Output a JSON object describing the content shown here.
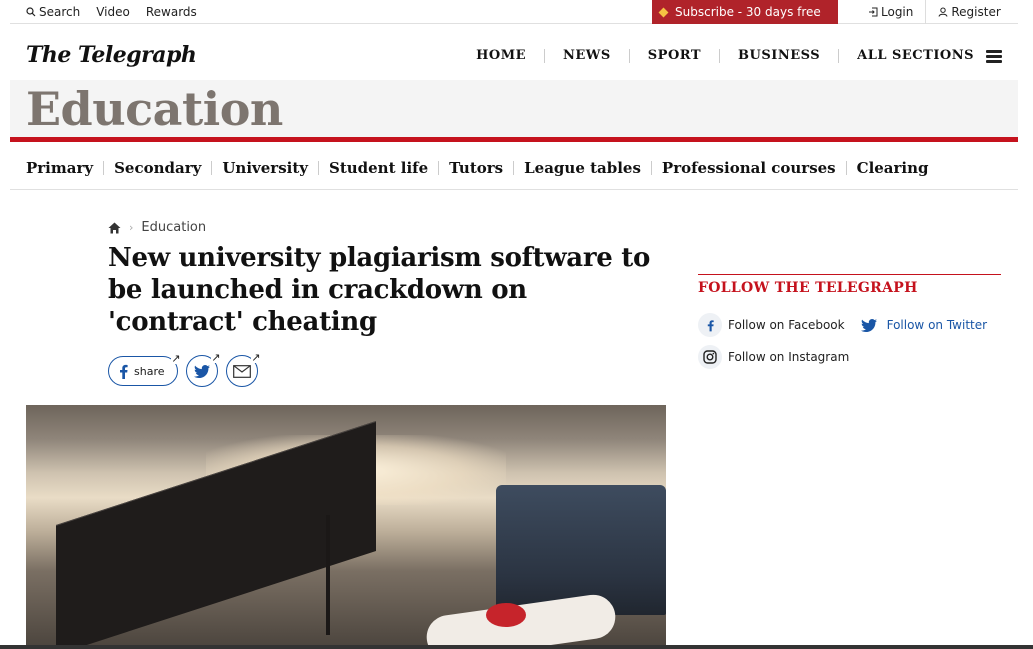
{
  "utility": {
    "search_label": "Search",
    "video_label": "Video",
    "rewards_label": "Rewards",
    "subscribe_label": "Subscribe - 30 days free",
    "login_label": "Login",
    "register_label": "Register"
  },
  "masthead": {
    "logo": "The Telegraph",
    "nav": [
      "HOME",
      "NEWS",
      "SPORT",
      "BUSINESS",
      "ALL SECTIONS"
    ]
  },
  "section": {
    "title": "Education",
    "subnav": [
      "Primary",
      "Secondary",
      "University",
      "Student life",
      "Tutors",
      "League tables",
      "Professional courses",
      "Clearing"
    ]
  },
  "article": {
    "breadcrumb": "Education",
    "headline": "New university plagiarism software to be launched in crackdown on 'contract' cheating",
    "share_label": "share"
  },
  "sidebar": {
    "follow_title": "FOLLOW THE TELEGRAPH",
    "facebook": "Follow on Facebook",
    "twitter": "Follow on Twitter",
    "instagram": "Follow on Instagram"
  },
  "colors": {
    "brand_red": "#c5121d",
    "subscribe_bg": "#b0232a",
    "link_blue": "#1a56a6",
    "section_title": "#7d756f"
  }
}
